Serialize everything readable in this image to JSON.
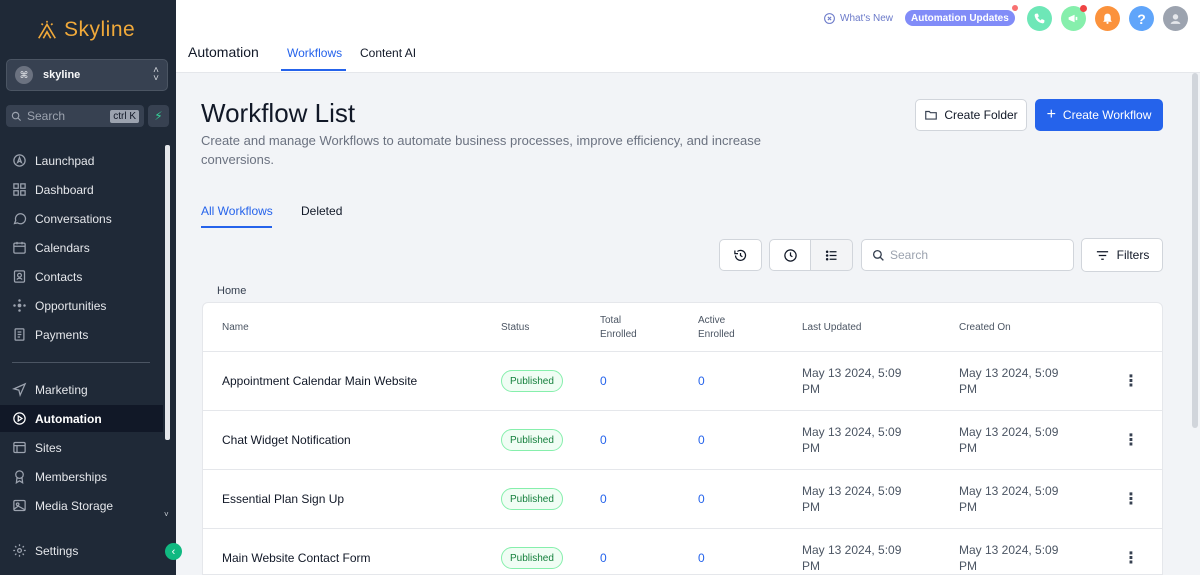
{
  "sidebar": {
    "brand": "Skyline",
    "account": {
      "name": "skyline"
    },
    "search": {
      "placeholder": "Search",
      "shortcut": "ctrl K"
    },
    "items": [
      {
        "label": "Launchpad",
        "icon": "launchpad-icon"
      },
      {
        "label": "Dashboard",
        "icon": "dashboard-icon"
      },
      {
        "label": "Conversations",
        "icon": "chat-icon"
      },
      {
        "label": "Calendars",
        "icon": "calendar-icon"
      },
      {
        "label": "Contacts",
        "icon": "contacts-icon"
      },
      {
        "label": "Opportunities",
        "icon": "opportunities-icon"
      },
      {
        "label": "Payments",
        "icon": "payments-icon"
      },
      {
        "label": "Marketing",
        "icon": "send-icon"
      },
      {
        "label": "Automation",
        "icon": "automation-icon",
        "active": true
      },
      {
        "label": "Sites",
        "icon": "globe-icon"
      },
      {
        "label": "Memberships",
        "icon": "memberships-icon"
      },
      {
        "label": "Media Storage",
        "icon": "image-icon"
      }
    ],
    "settings_label": "Settings"
  },
  "topbar": {
    "whats_new": "What's New",
    "automation_updates": "Automation Updates",
    "section_title": "Automation",
    "tabs": [
      {
        "label": "Workflows",
        "active": true
      },
      {
        "label": "Content AI",
        "active": false
      }
    ]
  },
  "page": {
    "title": "Workflow List",
    "subtitle": "Create and manage Workflows to automate business processes, improve efficiency, and increase conversions.",
    "create_folder_label": "Create Folder",
    "create_workflow_label": "Create Workflow",
    "subtabs": [
      {
        "label": "All Workflows",
        "active": true
      },
      {
        "label": "Deleted",
        "active": false
      }
    ],
    "search_placeholder": "Search",
    "filters_label": "Filters",
    "breadcrumb": "Home"
  },
  "table": {
    "columns": [
      "Name",
      "Status",
      "Total Enrolled",
      "Active Enrolled",
      "Last Updated",
      "Created On"
    ],
    "rows": [
      {
        "name": "Appointment Calendar Main Website",
        "status": "Published",
        "total": "0",
        "active": "0",
        "updated": "May 13 2024, 5:09 PM",
        "created": "May 13 2024, 5:09 PM"
      },
      {
        "name": "Chat Widget Notification",
        "status": "Published",
        "total": "0",
        "active": "0",
        "updated": "May 13 2024, 5:09 PM",
        "created": "May 13 2024, 5:09 PM"
      },
      {
        "name": "Essential Plan Sign Up",
        "status": "Published",
        "total": "0",
        "active": "0",
        "updated": "May 13 2024, 5:09 PM",
        "created": "May 13 2024, 5:09 PM"
      },
      {
        "name": "Main Website Contact Form",
        "status": "Published",
        "total": "0",
        "active": "0",
        "updated": "May 13 2024, 5:09 PM",
        "created": "May 13 2024, 5:09 PM"
      }
    ]
  },
  "colors": {
    "accent": "#2563eb",
    "sidebar_bg": "#1f2937",
    "published": "#15803d",
    "brand": "#f0a93a"
  }
}
